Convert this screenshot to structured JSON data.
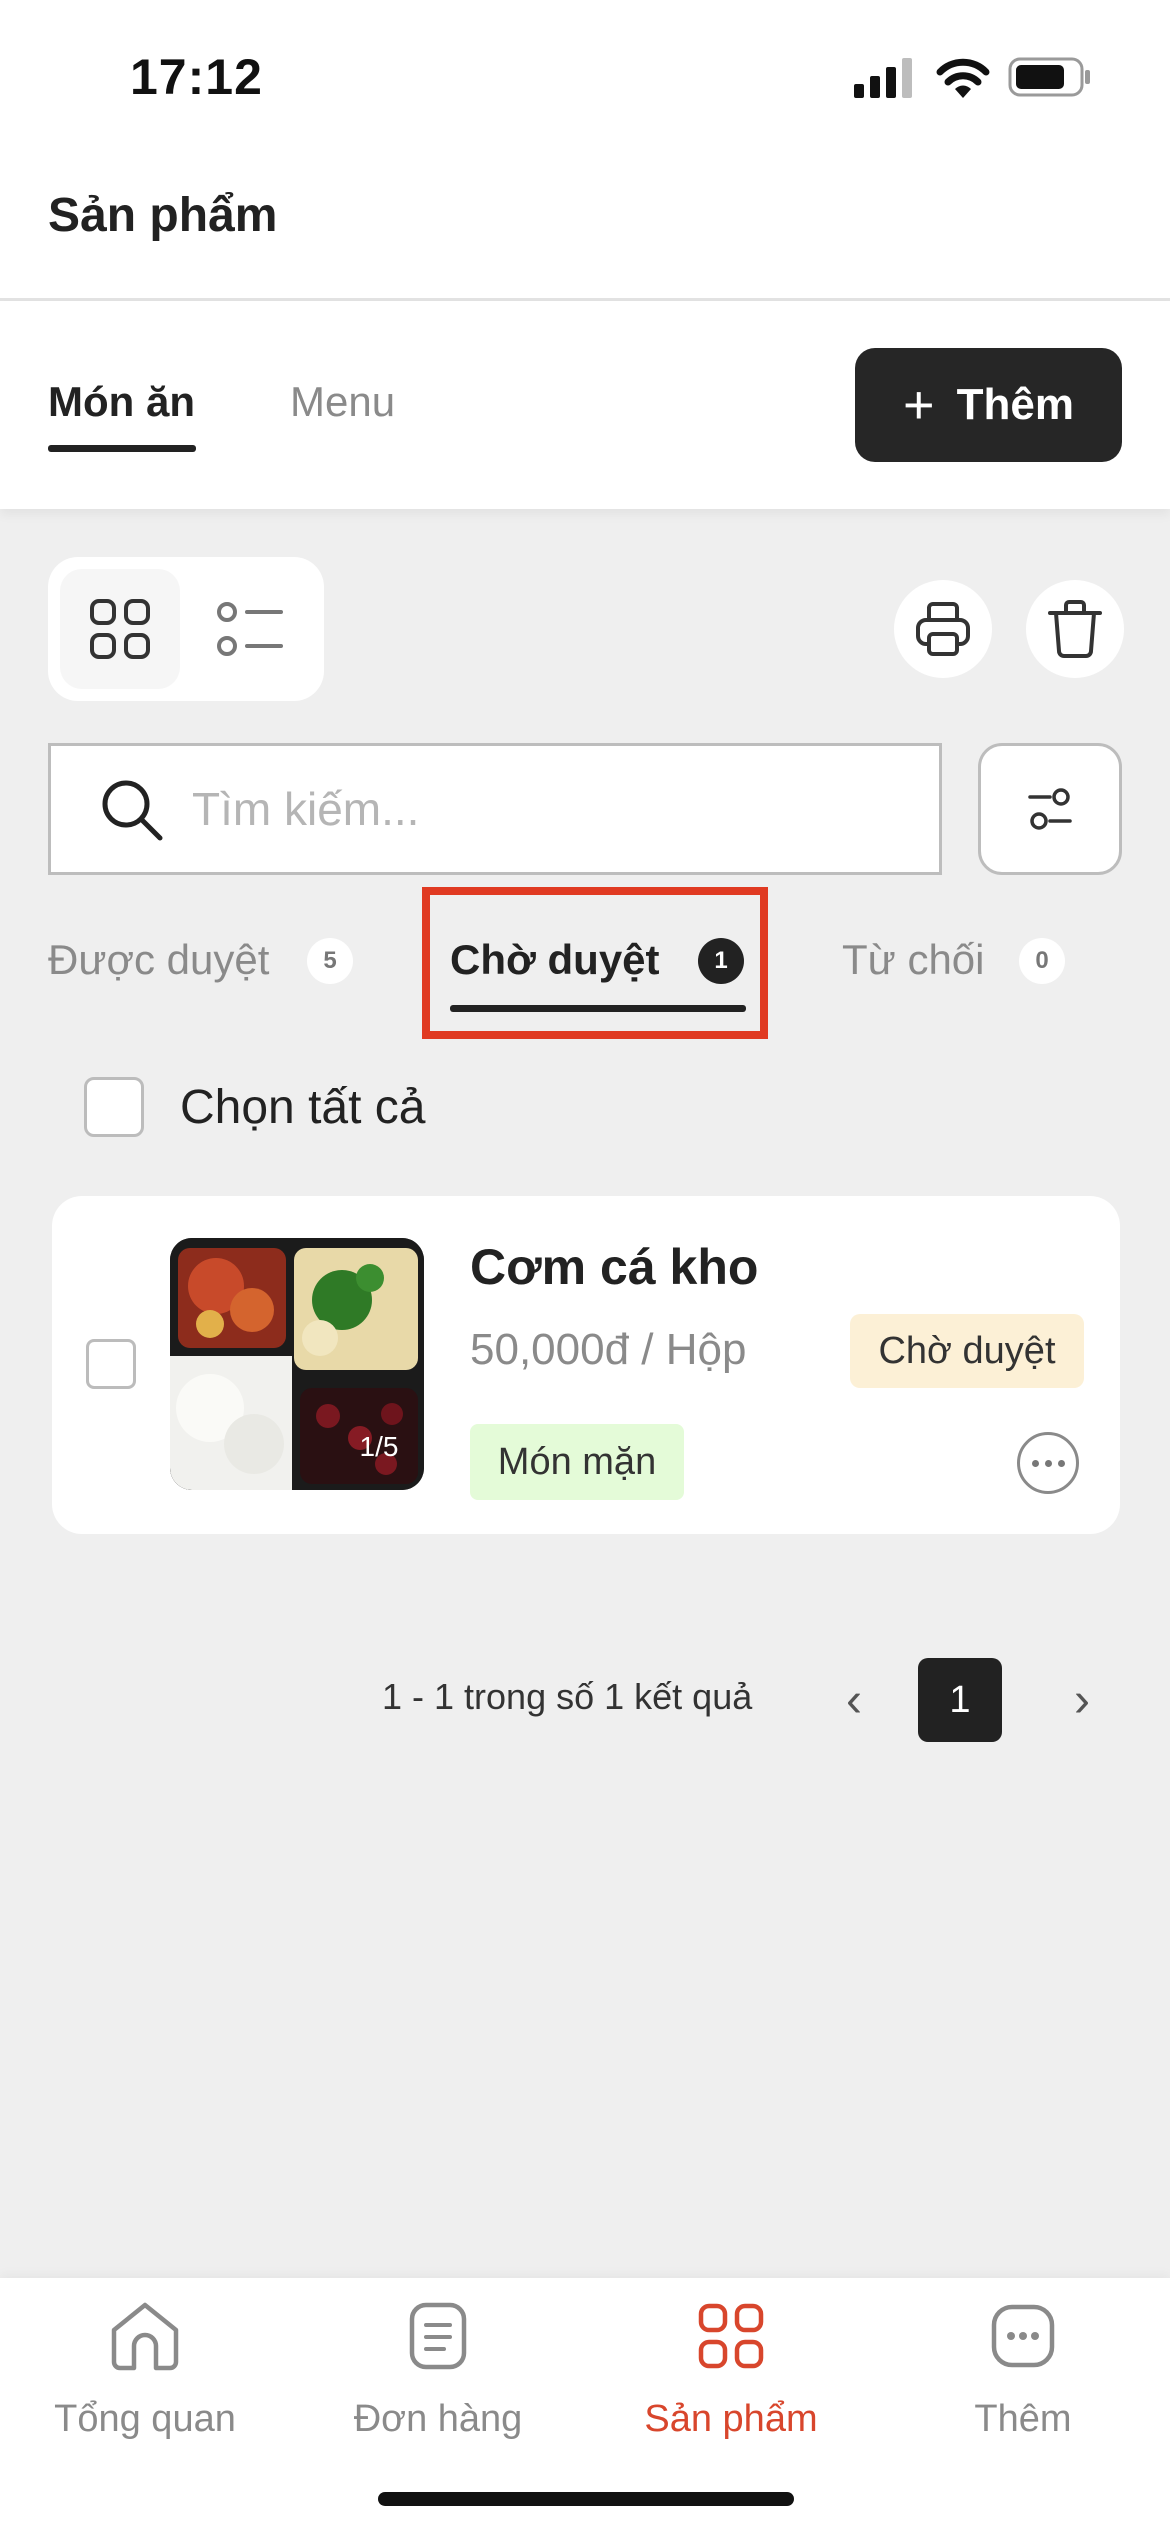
{
  "status_bar": {
    "time": "17:12"
  },
  "header": {
    "title": "Sản phẩm"
  },
  "top_tabs": [
    {
      "label": "Món ăn",
      "active": true
    },
    {
      "label": "Menu",
      "active": false
    }
  ],
  "add_button": {
    "icon": "plus-icon",
    "label": "Thêm"
  },
  "toolbar": {
    "view_modes": [
      "grid-view-icon",
      "list-view-icon"
    ],
    "active_view": "grid",
    "actions": [
      "print-icon",
      "trash-icon"
    ]
  },
  "search": {
    "placeholder": "Tìm kiếm...",
    "value": ""
  },
  "status_tabs": [
    {
      "label": "Được duyệt",
      "count": "5",
      "active": false
    },
    {
      "label": "Chờ duyệt",
      "count": "1",
      "active": true
    },
    {
      "label": "Từ chối",
      "count": "0",
      "active": false
    }
  ],
  "select_all": {
    "label": "Chọn tất cả",
    "checked": false
  },
  "products": [
    {
      "name": "Cơm cá kho",
      "price": "50,000đ / Hộp",
      "status": "Chờ duyệt",
      "category": "Món mặn",
      "image_counter": "1/5",
      "checked": false
    }
  ],
  "pagination": {
    "summary": "1 - 1 trong số 1 kết quả",
    "current_page": "1",
    "prev": "‹",
    "next": "›"
  },
  "bottom_nav": [
    {
      "label": "Tổng quan",
      "icon": "home-icon",
      "active": false
    },
    {
      "label": "Đơn hàng",
      "icon": "orders-icon",
      "active": false
    },
    {
      "label": "Sản phẩm",
      "icon": "products-icon",
      "active": true
    },
    {
      "label": "Thêm",
      "icon": "more-icon",
      "active": false
    }
  ],
  "colors": {
    "accent": "#d8462c",
    "highlight": "#e03a22",
    "dark": "#222222",
    "background": "#efefef",
    "pending_tag": "#fcf0d6",
    "category_tag": "#e4fbd8"
  }
}
